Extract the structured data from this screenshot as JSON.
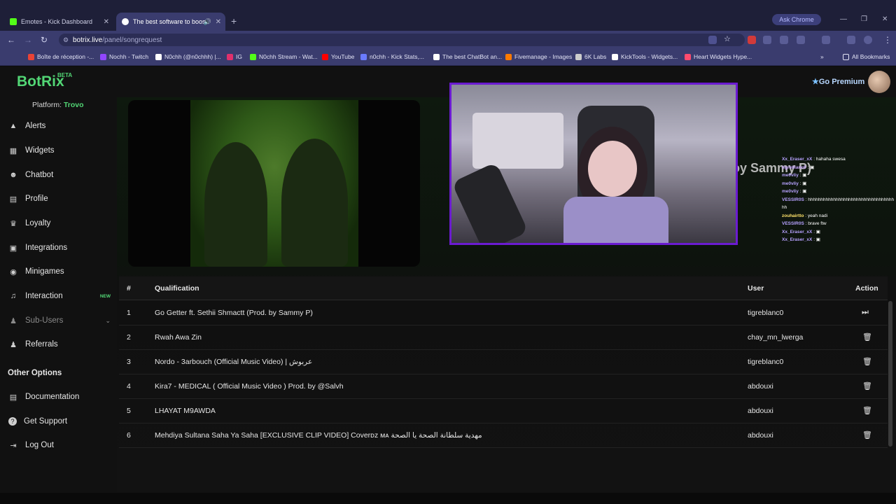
{
  "browser": {
    "tabs": [
      {
        "title": "Emotes - Kick Dashboard",
        "favicon_color": "#53fc18",
        "active": false
      },
      {
        "title": "The best software to boos",
        "favicon_color": "#ffffff",
        "active": true
      }
    ],
    "new_tab": "+",
    "ask_chrome": "Ask Chrome",
    "url_host": "botrix.live",
    "url_path": "/panel/songrequest",
    "bookmarks": [
      {
        "label": "Boîte de réception -...",
        "color": "#ea4335"
      },
      {
        "label": "Nochh - Twitch",
        "color": "#9146ff"
      },
      {
        "label": "N0chh (@n0chhh) |...",
        "color": "#ffffff"
      },
      {
        "label": "IG",
        "color": "#e1306c"
      },
      {
        "label": "N0chh Stream - Wat...",
        "color": "#53fc18"
      },
      {
        "label": "YouTube",
        "color": "#ff0000"
      },
      {
        "label": "n0chh - Kick Stats,...",
        "color": "#6a7bff"
      },
      {
        "label": "The best ChatBot an...",
        "color": "#ffffff"
      },
      {
        "label": "Fivemanage - Images",
        "color": "#ff7a00"
      },
      {
        "label": "6K Labs",
        "color": "#cccccc"
      },
      {
        "label": "KickTools - Widgets...",
        "color": "#ffffff"
      },
      {
        "label": "Heart Widgets Hype...",
        "color": "#ff4b6e"
      }
    ],
    "all_bookmarks": "All Bookmarks"
  },
  "sidebar": {
    "logo": "BotRix",
    "logo_badge": "BETA",
    "platform_label": "Platform:",
    "platform_value": "Trovo",
    "items": [
      {
        "label": "Alerts",
        "icon": "alert-triangle-icon",
        "glyph": "▲"
      },
      {
        "label": "Widgets",
        "icon": "grid-icon",
        "glyph": "▦"
      },
      {
        "label": "Chatbot",
        "icon": "robot-icon",
        "glyph": "☻"
      },
      {
        "label": "Profile",
        "icon": "id-card-icon",
        "glyph": "▤"
      },
      {
        "label": "Loyalty",
        "icon": "trophy-icon",
        "glyph": "♛"
      },
      {
        "label": "Integrations",
        "icon": "integration-icon",
        "glyph": "▣"
      },
      {
        "label": "Minigames",
        "icon": "gamepad-icon",
        "glyph": "◉"
      },
      {
        "label": "Interaction",
        "icon": "music-icon",
        "glyph": "♫",
        "badge": "NEW"
      },
      {
        "label": "Sub-Users",
        "icon": "users-icon",
        "glyph": "♟",
        "disabled": true
      },
      {
        "label": "Referrals",
        "icon": "referrals-icon",
        "glyph": "♟"
      }
    ],
    "other_options_title": "Other Options",
    "other_items": [
      {
        "label": "Documentation",
        "icon": "book-icon",
        "glyph": "▤"
      },
      {
        "label": "Get Support",
        "icon": "question-icon",
        "glyph": "?"
      },
      {
        "label": "Log Out",
        "icon": "logout-icon",
        "glyph": "⇥"
      }
    ]
  },
  "header": {
    "premium_label": "Go Premium",
    "premium_icon": "star-icon"
  },
  "now_playing": {
    "title_fragment": "oy Sammy P)"
  },
  "stream_chat": [
    {
      "name": "Xx_Eraser_xX",
      "text": ": hahaha swesa",
      "style": "nm"
    },
    {
      "name": "tigreblanc0",
      "text": ": ▣",
      "style": "nm2"
    },
    {
      "name": "me0vliy",
      "text": ": ▣",
      "style": "nm"
    },
    {
      "name": "me0vliy",
      "text": ": ▣",
      "style": "nm"
    },
    {
      "name": "me0vliy",
      "text": ": ▣",
      "style": "nm"
    },
    {
      "name": "VESSIR0S",
      "text": ": hhhhhhhhhhhhhhhhhhhhhhhhhhhhhhhhhhhh",
      "style": "nm"
    },
    {
      "name": "zouhairtto",
      "text": ": yeah nadi",
      "style": "yl"
    },
    {
      "name": "VESSIR0S",
      "text": ": brave ftw",
      "style": "nm"
    },
    {
      "name": "Xx_Eraser_xX",
      "text": ": ▣",
      "style": "nm"
    },
    {
      "name": "Xx_Eraser_xX",
      "text": ": ▣",
      "style": "nm"
    }
  ],
  "table": {
    "headers": {
      "num": "#",
      "qualification": "Qualification",
      "user": "User",
      "action": "Action"
    },
    "rows": [
      {
        "num": "1",
        "qualification": "Go Getter ft. Sethii Shmactt (Prod. by Sammy P)",
        "user": "tigreblanc0",
        "action": "skip-icon",
        "action_glyph": "⏭"
      },
      {
        "num": "2",
        "qualification": "Rwah Awa Zin",
        "user": "chay_mn_lwerga",
        "action": "trash-icon",
        "action_glyph": "🗑"
      },
      {
        "num": "3",
        "qualification": "Nordo - 3arbouch (Official Music Video) | عربوش",
        "user": "tigreblanc0",
        "action": "trash-icon",
        "action_glyph": "🗑"
      },
      {
        "num": "4",
        "qualification": "Kira7 - MEDICAL ( Official Music Video ) Prod. by @Salvh",
        "user": "abdouxi",
        "action": "trash-icon",
        "action_glyph": "🗑"
      },
      {
        "num": "5",
        "qualification": "LHAYAT M9AWDA",
        "user": "abdouxi",
        "action": "trash-icon",
        "action_glyph": "🗑"
      },
      {
        "num": "6",
        "qualification": "Mehdiya Sultana Saha Ya Saha [EXCLUSIVE CLIP VIDEO] Coverᴅᴢ ᴍᴀ مهدية سلطانة الصحة يا الصحة",
        "user": "abdouxi",
        "action": "trash-icon",
        "action_glyph": "🗑"
      }
    ]
  }
}
